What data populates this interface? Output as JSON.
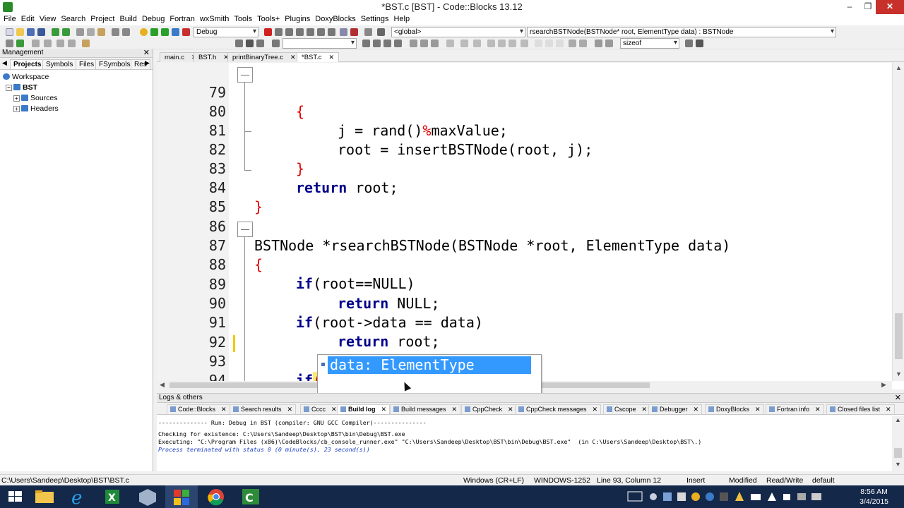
{
  "window": {
    "title": "*BST.c [BST] - Code::Blocks 13.12"
  },
  "menu": [
    "File",
    "Edit",
    "View",
    "Search",
    "Project",
    "Build",
    "Debug",
    "Fortran",
    "wxSmith",
    "Tools",
    "Tools+",
    "Plugins",
    "DoxyBlocks",
    "Settings",
    "Help"
  ],
  "toolbar": {
    "build_target": "Debug",
    "scope": "<global>",
    "function": "rsearchBSTNode(BSTNode* root, ElementType data) : BSTNode",
    "search_combo": "",
    "sizeof_combo": "sizeof"
  },
  "management": {
    "title": "Management",
    "tabs": [
      "Projects",
      "Symbols",
      "Files",
      "FSymbols",
      "Res"
    ],
    "tree": {
      "workspace": "Workspace",
      "project": "BST",
      "sources": "Sources",
      "headers": "Headers"
    }
  },
  "editor_tabs": [
    "main.c",
    "BST.h",
    "printBinaryTree.c",
    "*BST.c"
  ],
  "code": {
    "l79": {
      "num": "79",
      "text": "{"
    },
    "l80": {
      "num": "80",
      "pre": "j = rand()",
      "op": "%",
      "post": "maxValue;"
    },
    "l81": {
      "num": "81",
      "text": "root = insertBSTNode(root, j);"
    },
    "l82": {
      "num": "82",
      "text": "}"
    },
    "l83": {
      "num": "83",
      "kw": "return",
      "text": " root;"
    },
    "l84": {
      "num": "84",
      "text": "}"
    },
    "l85": {
      "num": "85"
    },
    "l86": {
      "num": "86",
      "text": "BSTNode *rsearchBSTNode(BSTNode *root, ElementType data)"
    },
    "l87": {
      "num": "87",
      "text": "{"
    },
    "l88": {
      "num": "88",
      "kw": "if",
      "text": "(root==NULL)"
    },
    "l89": {
      "num": "89",
      "kw": "return",
      "text": " NULL;"
    },
    "l90": {
      "num": "90",
      "kw": "if",
      "text": "(root->data == data)"
    },
    "l91": {
      "num": "91",
      "kw": "return",
      "text": " root;"
    },
    "l92": {
      "num": "92"
    },
    "l93": {
      "num": "93",
      "kw": "if",
      "paren_open": "(",
      "text": "data",
      "paren_close": ")"
    },
    "l94": {
      "num": "94",
      "text": "}"
    },
    "l95": {
      "num": "95"
    }
  },
  "autocomplete": {
    "item": "data: ElementType"
  },
  "logs": {
    "title": "Logs & others",
    "tabs": [
      "Code::Blocks",
      "Search results",
      "Cccc",
      "Build log",
      "Build messages",
      "CppCheck",
      "CppCheck messages",
      "Cscope",
      "Debugger",
      "DoxyBlocks",
      "Fortran info",
      "Closed files list"
    ],
    "lines": [
      "-------------- Run: Debug in BST (compiler: GNU GCC Compiler)---------------",
      "Checking for existence: C:\\Users\\Sandeep\\Desktop\\BST\\bin\\Debug\\BST.exe",
      "Executing: \"C:\\Program Files (x86)\\CodeBlocks/cb_console_runner.exe\" \"C:\\Users\\Sandeep\\Desktop\\BST\\bin\\Debug\\BST.exe\"  (in C:\\Users\\Sandeep\\Desktop\\BST\\.)",
      "Process terminated with status 0 (0 minute(s), 23 second(s))"
    ]
  },
  "status": {
    "path": "C:\\Users\\Sandeep\\Desktop\\BST\\BST.c",
    "eol": "Windows (CR+LF)",
    "encoding": "WINDOWS-1252",
    "position": "Line 93, Column 12",
    "mode": "Insert",
    "modified": "Modified",
    "access": "Read/Write",
    "profile": "default"
  },
  "taskbar": {
    "time": "8:56 AM",
    "date": "3/4/2015"
  },
  "colors": {
    "keyword": "#00008b",
    "operator": "#e00000",
    "selection": "#3399ff",
    "taskbar": "#14284a"
  }
}
